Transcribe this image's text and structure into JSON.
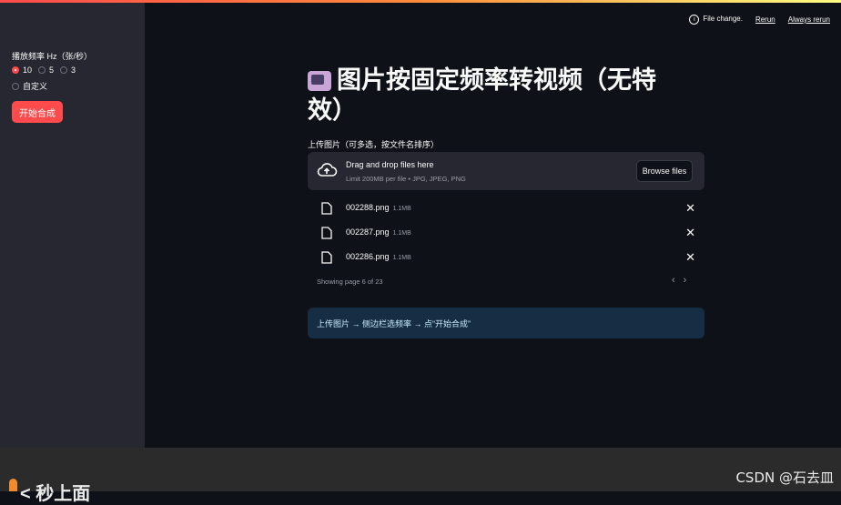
{
  "sidebar": {
    "rate_label": "播放频率 Hz（张/秒）",
    "rate_options": [
      {
        "label": "10",
        "selected": true
      },
      {
        "label": "5",
        "selected": false
      },
      {
        "label": "3",
        "selected": false
      },
      {
        "label": "自定义",
        "selected": false
      }
    ],
    "start_button": "开始合成"
  },
  "status": {
    "file_change": "File change.",
    "rerun": "Rerun",
    "always_rerun": "Always rerun"
  },
  "main": {
    "title": "图片按固定频率转视频（无特效）",
    "upload_label": "上传图片（可多选，按文件名排序）",
    "dropzone_title": "Drag and drop files here",
    "dropzone_sub": "Limit 200MB per file • JPG, JPEG, PNG",
    "browse_button": "Browse files",
    "files": [
      {
        "name": "002288.png",
        "size": "1.1MB"
      },
      {
        "name": "002287.png",
        "size": "1.1MB"
      },
      {
        "name": "002286.png",
        "size": "1.1MB"
      }
    ],
    "paging_text": "Showing page 6 of 23",
    "info_text": "上传图片 → 侧边栏选频率 → 点“开始合成”"
  },
  "bottom": {
    "partial_text": "< 秒上面",
    "watermark": "CSDN @石去皿"
  },
  "colors": {
    "accent": "#ff4b4b",
    "sidebar_bg": "#262730",
    "main_bg": "#0e1117",
    "info_bg": "#172d43"
  }
}
